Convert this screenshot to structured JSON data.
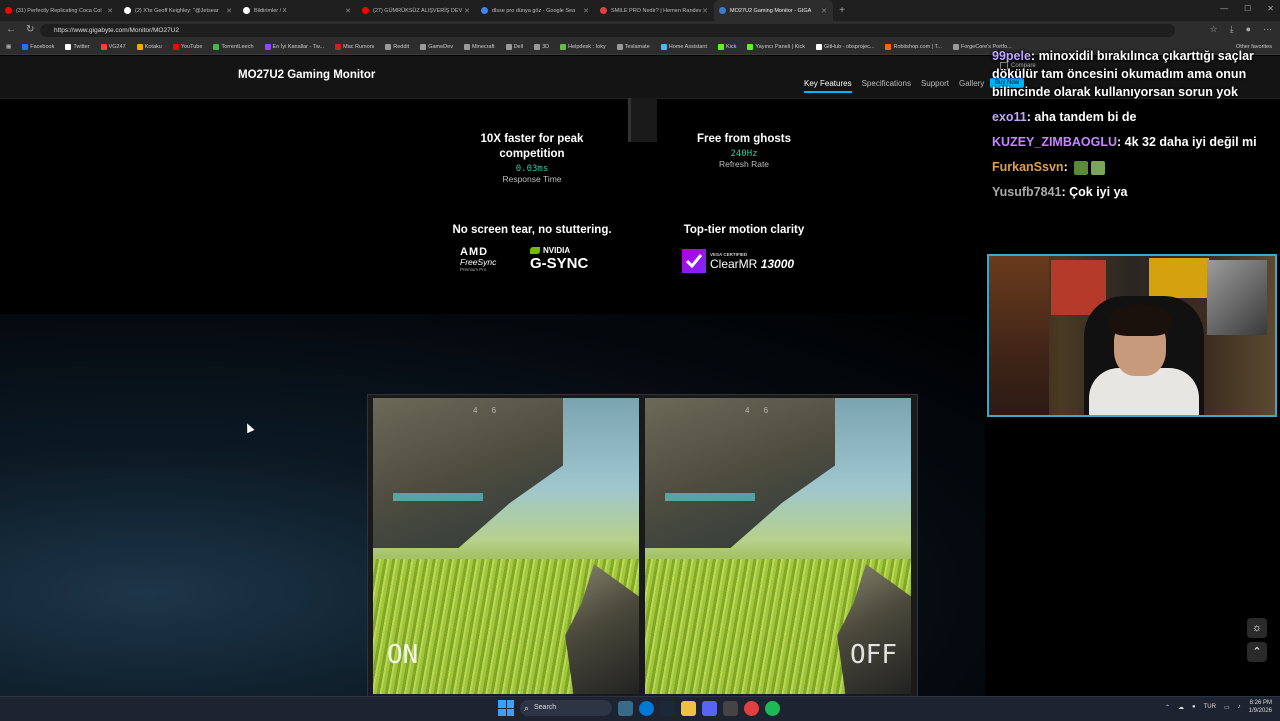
{
  "browser": {
    "tabs": [
      {
        "label": "(31) Perfectly Replicating Coca Col",
        "color": "#ff0000"
      },
      {
        "label": "(2) X'te Geoff Keighley: \"@Jetsear",
        "color": "#ffffff"
      },
      {
        "label": "Bildirimler / X",
        "color": "#ffffff"
      },
      {
        "label": "(27) GÜMRÜKSÜZ ALIŞVERİŞ DEV",
        "color": "#ff0000"
      },
      {
        "label": "dlsse pro dünya göz - Google Sea",
        "color": "#4285f4"
      },
      {
        "label": "SMILE PRO Nedir? | Hemen Randev",
        "color": "#e04040"
      },
      {
        "label": "MO27U2 Gaming Monitor - GIGA",
        "color": "#3a7bd5",
        "active": true
      }
    ],
    "url": "https://www.gigabyte.com/Monitor/MO27U2",
    "bookmarks": [
      {
        "label": "Facebook",
        "color": "#1877f2"
      },
      {
        "label": "Twitter",
        "color": "#ffffff"
      },
      {
        "label": "VG247",
        "color": "#ff3b3b"
      },
      {
        "label": "Kotaku",
        "color": "#f2a900"
      },
      {
        "label": "YouTube",
        "color": "#ff0000"
      },
      {
        "label": "TorrentLeech",
        "color": "#47b747"
      },
      {
        "label": "En İyi Kanallar - Tw...",
        "color": "#9146ff"
      },
      {
        "label": "Mac Rumors",
        "color": "#cc2222"
      },
      {
        "label": "Reddit",
        "color": "#999999"
      },
      {
        "label": "GameDev",
        "color": "#999999"
      },
      {
        "label": "Minecraft",
        "color": "#999999"
      },
      {
        "label": "Dell",
        "color": "#999999"
      },
      {
        "label": "3D",
        "color": "#999999"
      },
      {
        "label": "Helpdesk : Ioky",
        "color": "#66bb44"
      },
      {
        "label": "Teslamate",
        "color": "#999999"
      },
      {
        "label": "Home Assistant",
        "color": "#41bdf5"
      },
      {
        "label": "Kick",
        "color": "#53fc18"
      },
      {
        "label": "Yayıncı Paneli | Kick",
        "color": "#53fc18"
      },
      {
        "label": "GitHub - obsprojec...",
        "color": "#ffffff"
      },
      {
        "label": "Robitshop.com | T...",
        "color": "#ff6600"
      },
      {
        "label": "ForgeCore's Portfo...",
        "color": "#999999"
      }
    ],
    "other_bookmarks": "Other favorites"
  },
  "site": {
    "title": "MO27U2 Gaming Monitor",
    "nav": [
      "Key Features",
      "Specifications",
      "Support",
      "Gallery"
    ],
    "buy_now": "Buy Now",
    "compare": "Compare"
  },
  "features": {
    "response": {
      "heading": "10X faster for peak competition",
      "value": "0.03ms",
      "sub": "Response Time"
    },
    "refresh": {
      "heading": "Free from ghosts",
      "value": "240Hz",
      "sub": "Refresh Rate"
    },
    "sync": {
      "heading": "No screen tear, no stuttering."
    },
    "clarity": {
      "heading": "Top-tier motion clarity"
    }
  },
  "logos": {
    "amd": "AMD",
    "freesync": "FreeSync",
    "freesync_sub": "Premium Pro",
    "nvidia": "NVIDIA",
    "gsync": "G-SYNC",
    "vesa": "VESA CERTIFIED",
    "clearmr": "ClearMR",
    "clearmr_num": "13000"
  },
  "comparison": {
    "on_label": "ON",
    "off_label": "OFF",
    "hud": "4 6"
  },
  "chat": [
    {
      "user": "99pele",
      "text": "minoxidil bırakılınca çıkarttığı saçlar dökülür tam öncesini okumadım ama onun bilincinde olarak kullanıyorsan sorun yok"
    },
    {
      "user": "exo11",
      "text": "aha tandem bi de"
    },
    {
      "user": "KUZEY_ZIMBAOGLU",
      "text": "4k 32 daha iyi değil mi"
    },
    {
      "user": "FurkanSsvn",
      "text": ""
    },
    {
      "user": "Yusufb7841",
      "text": "Çok iyi ya"
    }
  ],
  "taskbar": {
    "search": "Search",
    "lang": "TUR",
    "time": "8:26 PM",
    "date": "1/9/2026"
  }
}
